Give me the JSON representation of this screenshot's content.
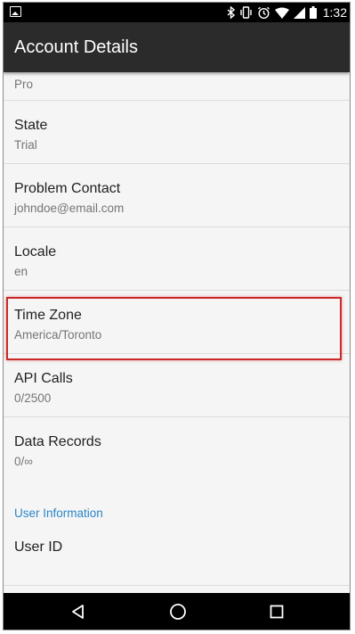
{
  "status_bar": {
    "time": "1:32",
    "icons": [
      "image-icon",
      "bluetooth-icon",
      "vibrate-icon",
      "alarm-icon",
      "wifi-icon",
      "signal-icon",
      "battery-icon"
    ]
  },
  "app_bar": {
    "title": "Account Details"
  },
  "list": {
    "partial_item_value": "Pro",
    "items": [
      {
        "label": "State",
        "value": "Trial"
      },
      {
        "label": "Problem Contact",
        "value": "johndoe@email.com"
      },
      {
        "label": "Locale",
        "value": "en"
      },
      {
        "label": "Time Zone",
        "value": "America/Toronto"
      },
      {
        "label": "API Calls",
        "value": "0/2500"
      },
      {
        "label": "Data Records",
        "value": "0/∞"
      }
    ],
    "section_header": "User Information",
    "user_id_label": "User ID"
  },
  "nav_bar": {
    "icons": [
      "back-icon",
      "home-icon",
      "recents-icon"
    ]
  },
  "colors": {
    "app_bar": "#2b2b2b",
    "section_header": "#2b86c8",
    "highlight": "#cc2a2a",
    "background": "#f5f5f5"
  }
}
